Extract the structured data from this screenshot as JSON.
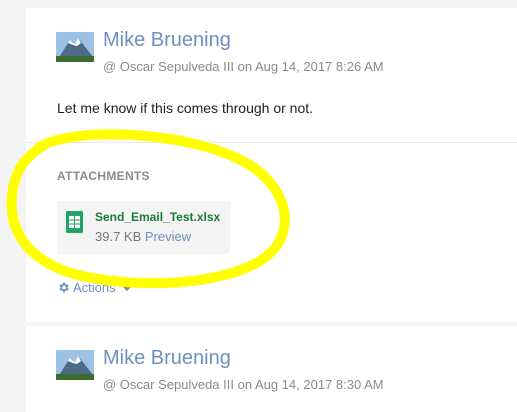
{
  "posts": [
    {
      "author": "Mike Bruening",
      "meta": "@ Oscar Sepulveda III on Aug 14, 2017 8:26 AM",
      "message": "Let me know if this comes through or not.",
      "attachments_heading": "ATTACHMENTS",
      "attachment": {
        "icon": "spreadsheet-icon",
        "file_name": "Send_Email_Test.xlsx",
        "file_size": "39.7 KB",
        "preview_label": "Preview"
      },
      "actions_label": "Actions"
    },
    {
      "author": "Mike Bruening",
      "meta": "@ Oscar Sepulveda III on Aug 14, 2017 8:30 AM"
    }
  ],
  "colors": {
    "link": "#6d8fc2",
    "file_name": "#1e7a3a",
    "highlight": "#ffff00"
  }
}
